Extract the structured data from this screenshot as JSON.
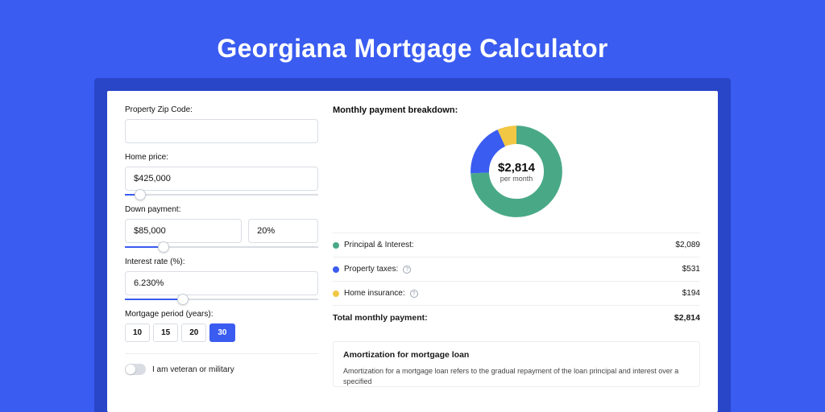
{
  "title": "Georgiana Mortgage Calculator",
  "left": {
    "zip_label": "Property Zip Code:",
    "zip_value": "",
    "home_price_label": "Home price:",
    "home_price_value": "$425,000",
    "home_price_slider_pct": 8,
    "down_payment_label": "Down payment:",
    "down_payment_value": "$85,000",
    "down_payment_pct": "20%",
    "down_payment_slider_pct": 20,
    "interest_label": "Interest rate (%):",
    "interest_value": "6.230%",
    "interest_slider_pct": 30,
    "period_label": "Mortgage period (years):",
    "periods": [
      {
        "label": "10",
        "active": false
      },
      {
        "label": "15",
        "active": false
      },
      {
        "label": "20",
        "active": false
      },
      {
        "label": "30",
        "active": true
      }
    ],
    "veteran_label": "I am veteran or military"
  },
  "right": {
    "breakdown_title": "Monthly payment breakdown:",
    "center_amount": "$2,814",
    "center_sub": "per month",
    "legend": [
      {
        "label": "Principal & Interest:",
        "value": "$2,089",
        "info": false,
        "color": "#49a987"
      },
      {
        "label": "Property taxes:",
        "value": "$531",
        "info": true,
        "color": "#3a5cf0"
      },
      {
        "label": "Home insurance:",
        "value": "$194",
        "info": true,
        "color": "#f2c744"
      }
    ],
    "total_label": "Total monthly payment:",
    "total_value": "$2,814",
    "amort_title": "Amortization for mortgage loan",
    "amort_text": "Amortization for a mortgage loan refers to the gradual repayment of the loan principal and interest over a specified"
  },
  "chart_data": {
    "type": "pie",
    "title": "Monthly payment breakdown",
    "total": 2814,
    "series": [
      {
        "name": "Principal & Interest",
        "value": 2089,
        "pct": 74.2,
        "color": "#49a987"
      },
      {
        "name": "Property taxes",
        "value": 531,
        "pct": 18.9,
        "color": "#3a5cf0"
      },
      {
        "name": "Home insurance",
        "value": 194,
        "pct": 6.9,
        "color": "#f2c744"
      }
    ]
  },
  "colors": {
    "bg": "#3a5cf0",
    "band": "#2946c8",
    "green": "#49a987",
    "blue": "#3a5cf0",
    "yellow": "#f2c744"
  }
}
